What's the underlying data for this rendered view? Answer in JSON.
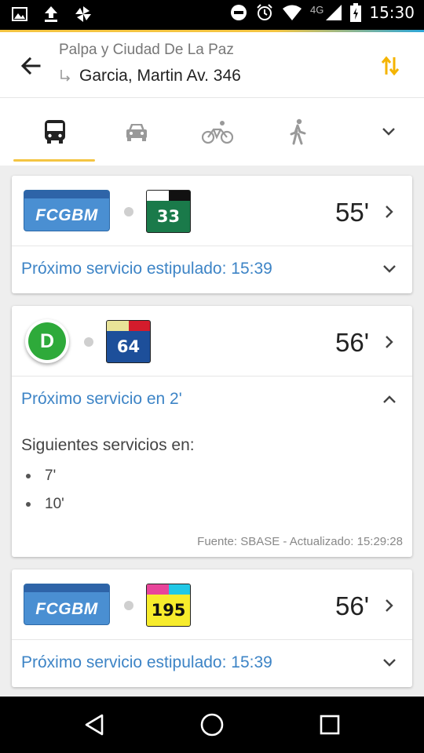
{
  "status_bar": {
    "network": "4G",
    "time": "15:30",
    "icons": [
      "image-icon",
      "upload-icon",
      "pinwheel-icon",
      "dnd-icon",
      "alarm-icon",
      "wifi-icon",
      "signal-icon",
      "battery-icon"
    ]
  },
  "header": {
    "from": "Palpa y Ciudad De La Paz",
    "to": "Garcia, Martin Av. 346"
  },
  "tabs": [
    {
      "name": "bus",
      "active": true
    },
    {
      "name": "car",
      "active": false
    },
    {
      "name": "bike",
      "active": false
    },
    {
      "name": "walk",
      "active": false
    }
  ],
  "cards": [
    {
      "line_logo": "FCGBM",
      "route_number": "33",
      "eta": "55'",
      "next_service": "Próximo servicio estipulado: 15:39"
    },
    {
      "line_badge": "D",
      "route_number": "64",
      "eta": "56'",
      "next_service": "Próximo servicio en 2'",
      "following_title": "Siguientes servicios en:",
      "following": [
        "7'",
        "10'"
      ],
      "source": "Fuente: SBASE - Actualizado: 15:29:28"
    },
    {
      "line_logo": "FCGBM",
      "route_number": "195",
      "eta": "56'",
      "next_service": "Próximo servicio estipulado: 15:39"
    }
  ],
  "colors": {
    "accent_yellow": "#f4c542",
    "link_blue": "#3d84c6",
    "route33_bg": "#1a7a4a",
    "route64_bg": "#1d4f9a",
    "route195_bg": "#f7ec2c"
  }
}
